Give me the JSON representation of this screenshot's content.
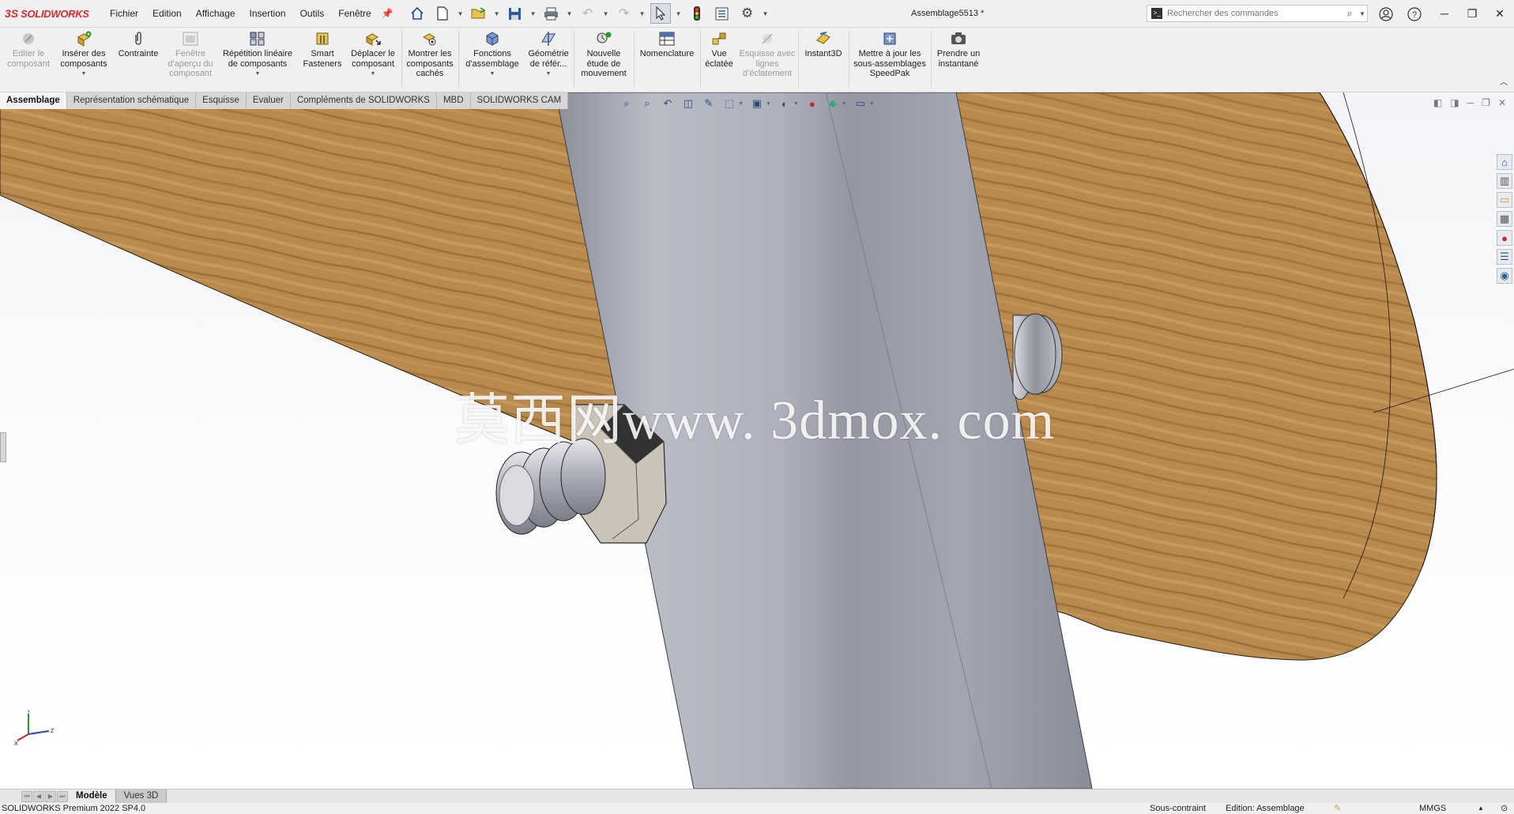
{
  "app": {
    "logo_text": "SOLIDWORKS",
    "document_title": "Assemblage5513 *"
  },
  "menu": [
    "Fichier",
    "Edition",
    "Affichage",
    "Insertion",
    "Outils",
    "Fenêtre"
  ],
  "search": {
    "placeholder": "Rechercher des commandes"
  },
  "ribbon": {
    "edit_component": "Editer le composant",
    "insert_components": "Insérer des composants",
    "mate": "Contrainte",
    "component_preview": "Fenêtre d'aperçu du composant",
    "linear_pattern": "Répétition linéaire de composants",
    "smart_fasteners": "Smart Fasteners",
    "move_component": "Déplacer le composant",
    "show_hidden": "Montrer les composants cachés",
    "assembly_features": "Fonctions d'assemblage",
    "reference_geometry": "Géométrie de référ...",
    "new_motion_study": "Nouvelle étude de mouvement",
    "bom": "Nomenclature",
    "exploded_view": "Vue éclatée",
    "explode_line_sketch": "Esquisse avec lignes d'éclatement",
    "instant3d": "Instant3D",
    "update_speedpak": "Mettre à jour les sous-assemblages SpeedPak",
    "take_snapshot": "Prendre un instantané"
  },
  "tabs": [
    "Assemblage",
    "Représentation schématique",
    "Esquisse",
    "Evaluer",
    "Compléments de SOLIDWORKS",
    "MBD",
    "SOLIDWORKS CAM"
  ],
  "viewport": {
    "watermark": "莫西网www. 3dmox. com"
  },
  "bottom_tabs": [
    "Modèle",
    "Vues 3D"
  ],
  "status": {
    "product": "SOLIDWORKS Premium 2022 SP4.0",
    "constraint": "Sous-contraint",
    "editing": "Edition: Assemblage",
    "units": "MMGS"
  },
  "colors": {
    "brand": "#d22c2c",
    "wood": "#b98a4e",
    "steel": "#a8aab5"
  }
}
